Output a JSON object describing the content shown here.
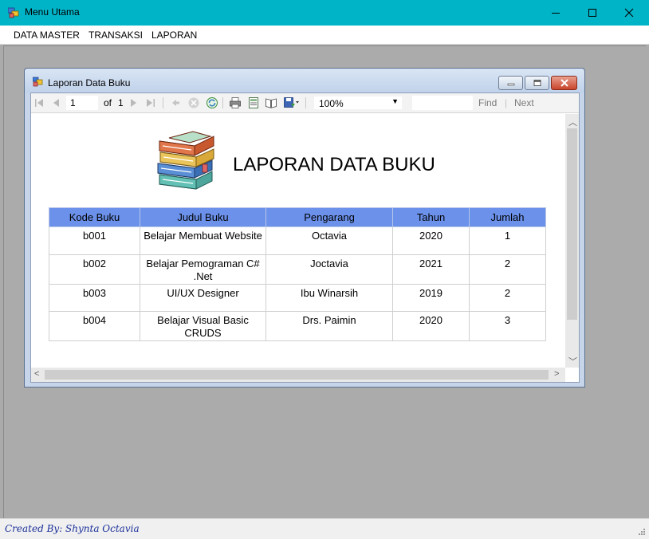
{
  "window": {
    "title": "Menu Utama",
    "accent_color": "#00b4c8"
  },
  "menubar": {
    "items": [
      "DATA MASTER",
      "TRANSAKSI",
      "LAPORAN"
    ]
  },
  "child_window": {
    "title": "Laporan Data Buku"
  },
  "toolbar": {
    "current_page": "1",
    "of_label": "of",
    "total_pages": "1",
    "zoom": "100%",
    "find_label": "Find",
    "separator": "|",
    "next_label": "Next"
  },
  "report": {
    "title": "LAPORAN DATA BUKU",
    "header_color": "#6b91ea",
    "columns": [
      "Kode Buku",
      "Judul Buku",
      "Pengarang",
      "Tahun",
      "Jumlah"
    ],
    "rows": [
      {
        "kode": "b001",
        "judul": "Belajar Membuat Website",
        "judul2": "",
        "pengarang": "Octavia",
        "tahun": "2020",
        "jumlah": "1"
      },
      {
        "kode": "b002",
        "judul": "Belajar Pemograman C#",
        "judul2": ".Net",
        "pengarang": "Joctavia",
        "tahun": "2021",
        "jumlah": "2"
      },
      {
        "kode": "b003",
        "judul": "UI/UX Designer",
        "judul2": "",
        "pengarang": "Ibu Winarsih",
        "tahun": "2019",
        "jumlah": "2"
      },
      {
        "kode": "b004",
        "judul": "Belajar Visual Basic",
        "judul2": "CRUDS",
        "pengarang": "Drs. Paimin",
        "tahun": "2020",
        "jumlah": "3"
      }
    ]
  },
  "statusbar": {
    "created_by": "Created By: Shynta Octavia",
    "text_color": "#1a2f9a"
  }
}
